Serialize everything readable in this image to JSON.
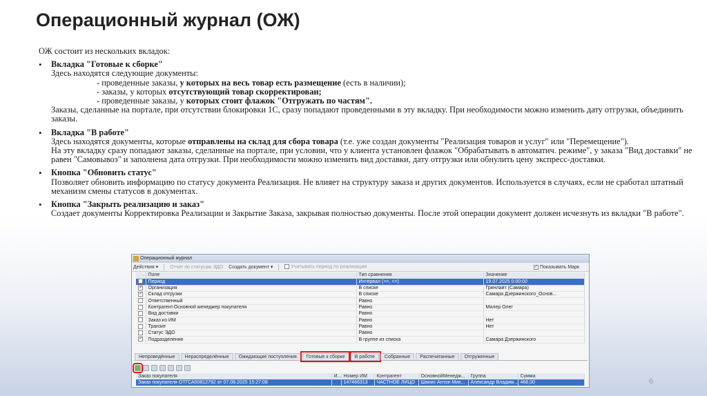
{
  "slide": {
    "title": "Операционный журнал (ОЖ)",
    "page_number": "6"
  },
  "content": {
    "intro": "ОЖ состоит из нескольких вкладок:",
    "section1": {
      "title": "Вкладка \"Готовые к сборке\"",
      "line1": "Здесь находятся следующие документы:",
      "item1_pre": "- проведенные заказы, ",
      "item1_bold": "у которых на весь товар есть размещение",
      "item1_post": " (есть в наличии);",
      "item2_pre": "- заказы, у которых ",
      "item2_bold": "отсутствующий товар скорректирован;",
      "item3_pre": "- проведенные заказы, у ",
      "item3_bold": "которых стоит флажок \"Отгружать по частям\".",
      "text": "Заказы, сделанные на портале, при отсутствии блокировки 1С, сразу попадают проведенными в эту вкладку. При необходимости можно изменить дату отгрузки, объединить заказы."
    },
    "section2": {
      "title": "Вкладка \"В работе\"",
      "line_pre": "Здесь находятся документы, которые ",
      "line_bold": "отправлены на склад для сбора товара",
      "line_post": " (т.е. уже создан документы \"Реализация товаров и услуг\" или \"Перемещение\").",
      "text": "На эту вкладку сразу попадают заказы, сделанные на портале, при условии, что у клиента установлен флажок \"Обрабатывать в автоматич. режиме\", у заказа \"Вид доставки\" не равен \"Самовывоз\" и заполнена дата отгрузки. При необходимости можно изменить вид доставки, дату отгрузки или обнулить цену экспресс-доставки."
    },
    "section3": {
      "title": "Кнопка \"Обновить статус\"",
      "text": "Позволяет обновить информацию по статусу документа Реализация. Не влияет на структуру заказа и других документов. Используется в случаях, если не сработал штатный механизм смены статусов в документах."
    },
    "section4": {
      "title": "Кнопка \"Закрыть реализацию и заказ\"",
      "text": "Создает документы Корректировка Реализации и Закрытие Заказа, закрывая полностью документы. После этой операции документ должен исчезнуть из вкладки \"В работе\"."
    }
  },
  "window": {
    "title": "Операционный журнал",
    "toolbar": {
      "actions": "Действия ▾",
      "report": "Отчет по статусам ЭДО",
      "create": "Создать документ ▾",
      "consider_period": "Учитывать период по реализации",
      "show_mark": "Показывать Марк"
    },
    "filter_headers": [
      "Поле",
      "Тип сравнения",
      "Значение"
    ],
    "filter_rows": [
      {
        "checked": true,
        "field": "Период",
        "cmp": "Интервал (>=, <=)",
        "value": "19.07.2025 0:00:00",
        "selected": true
      },
      {
        "checked": true,
        "field": "Организация",
        "cmp": "В списке",
        "value": "Гринлайт (Самара)"
      },
      {
        "checked": true,
        "field": "Склад отгрузки",
        "cmp": "В списке",
        "value": "Самара Дзержинского_Основ..."
      },
      {
        "checked": false,
        "field": "Ответственный",
        "cmp": "Равно",
        "value": ""
      },
      {
        "checked": false,
        "field": "Контрагент.Основной менеджер покупателя",
        "cmp": "Равно",
        "value": "Милер Олег"
      },
      {
        "checked": false,
        "field": "Вид доставки",
        "cmp": "Равно",
        "value": ""
      },
      {
        "checked": false,
        "field": "Заказ из ИМ",
        "cmp": "Равно",
        "value": "Нет"
      },
      {
        "checked": false,
        "field": "Транзит",
        "cmp": "Равно",
        "value": "Нет"
      },
      {
        "checked": false,
        "field": "Статус ЭДО",
        "cmp": "Равно",
        "value": ""
      },
      {
        "checked": true,
        "field": "Подразделение",
        "cmp": "В группе из списка",
        "value": "Самара Дзержинского"
      }
    ],
    "tabs": [
      {
        "label": "Непроведённые",
        "highlight": false
      },
      {
        "label": "Нераспределённые",
        "highlight": false
      },
      {
        "label": "Ожидающие поступления",
        "highlight": false
      },
      {
        "label": "Готовые к сборке",
        "highlight": true
      },
      {
        "label": "В работе",
        "highlight": true
      },
      {
        "label": "Собранные",
        "highlight": false
      },
      {
        "label": "Распечатанные",
        "highlight": false
      },
      {
        "label": "Отгруженные",
        "highlight": false
      }
    ],
    "order_headers": [
      "Заказ покупателя",
      "И...",
      "Номер ИМ",
      "Контрагент",
      "ОсновнойМенедж...",
      "Группа",
      "Сумма"
    ],
    "order_row": [
      "Заказ покупателя ОТГСА00812792 от 07.08.2025 15:27:08",
      "",
      "147466313",
      "ЧАСТНОЕ ЛИЦО",
      "Шанис Антон Мих...",
      "Александр Владим...",
      "468,00"
    ]
  },
  "colors": {
    "highlight_red": "#d61e1e",
    "selection_blue": "#3a6fc5"
  }
}
